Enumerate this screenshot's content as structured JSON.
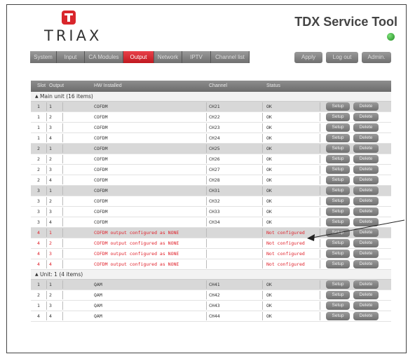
{
  "brand": {
    "logo_text": "TRIAX",
    "tool_title": "TDX Service Tool",
    "status_color": "#2a9d2a"
  },
  "nav": {
    "tabs": [
      {
        "label": "System",
        "active": false
      },
      {
        "label": "Input",
        "active": false
      },
      {
        "label": "CA Modules",
        "active": false
      },
      {
        "label": "Output",
        "active": true
      },
      {
        "label": "Network",
        "active": false
      },
      {
        "label": "IPTV",
        "active": false
      },
      {
        "label": "Channel list",
        "active": false
      }
    ],
    "apply_label": "Apply",
    "logout_label": "Log out",
    "admin_label": "Admin."
  },
  "table": {
    "headers": {
      "slot": "Slot",
      "output": "Output",
      "hw": "HW Installed",
      "channel": "Channel",
      "status": "Status"
    },
    "setup_label": "Setup",
    "delete_label": "Delete",
    "groups": [
      {
        "label": "Main unit (16 items)",
        "rows": [
          {
            "slot": "1",
            "output": "1",
            "hw": "COFDM",
            "channel": "CH21",
            "status": "OK",
            "shade": true,
            "error": false
          },
          {
            "slot": "1",
            "output": "2",
            "hw": "COFDM",
            "channel": "CH22",
            "status": "OK",
            "shade": false,
            "error": false
          },
          {
            "slot": "1",
            "output": "3",
            "hw": "COFDM",
            "channel": "CH23",
            "status": "OK",
            "shade": false,
            "error": false
          },
          {
            "slot": "1",
            "output": "4",
            "hw": "COFDM",
            "channel": "CH24",
            "status": "OK",
            "shade": false,
            "error": false
          },
          {
            "slot": "2",
            "output": "1",
            "hw": "COFDM",
            "channel": "CH25",
            "status": "OK",
            "shade": true,
            "error": false
          },
          {
            "slot": "2",
            "output": "2",
            "hw": "COFDM",
            "channel": "CH26",
            "status": "OK",
            "shade": false,
            "error": false
          },
          {
            "slot": "2",
            "output": "3",
            "hw": "COFDM",
            "channel": "CH27",
            "status": "OK",
            "shade": false,
            "error": false
          },
          {
            "slot": "2",
            "output": "4",
            "hw": "COFDM",
            "channel": "CH28",
            "status": "OK",
            "shade": false,
            "error": false
          },
          {
            "slot": "3",
            "output": "1",
            "hw": "COFDM",
            "channel": "CH31",
            "status": "OK",
            "shade": true,
            "error": false
          },
          {
            "slot": "3",
            "output": "2",
            "hw": "COFDM",
            "channel": "CH32",
            "status": "OK",
            "shade": false,
            "error": false
          },
          {
            "slot": "3",
            "output": "3",
            "hw": "COFDM",
            "channel": "CH33",
            "status": "OK",
            "shade": false,
            "error": false
          },
          {
            "slot": "3",
            "output": "4",
            "hw": "COFDM",
            "channel": "CH34",
            "status": "OK",
            "shade": false,
            "error": false
          },
          {
            "slot": "4",
            "output": "1",
            "hw": "COFDM output configured as NONE",
            "channel": "",
            "status": "Not configured",
            "shade": true,
            "error": true
          },
          {
            "slot": "4",
            "output": "2",
            "hw": "COFDM output configured as NONE",
            "channel": "",
            "status": "Not configured",
            "shade": false,
            "error": true
          },
          {
            "slot": "4",
            "output": "3",
            "hw": "COFDM output configured as NONE",
            "channel": "",
            "status": "Not configured",
            "shade": false,
            "error": true
          },
          {
            "slot": "4",
            "output": "4",
            "hw": "COFDM output configured as NONE",
            "channel": "",
            "status": "Not configured",
            "shade": false,
            "error": true
          }
        ]
      },
      {
        "label": "Unit: 1 (4 items)",
        "rows": [
          {
            "slot": "1",
            "output": "1",
            "hw": "QAM",
            "channel": "CH41",
            "status": "OK",
            "shade": true,
            "error": false
          },
          {
            "slot": "2",
            "output": "2",
            "hw": "QAM",
            "channel": "CH42",
            "status": "OK",
            "shade": false,
            "error": false
          },
          {
            "slot": "1",
            "output": "3",
            "hw": "QAM",
            "channel": "CH43",
            "status": "OK",
            "shade": false,
            "error": false
          },
          {
            "slot": "4",
            "output": "4",
            "hw": "QAM",
            "channel": "CH44",
            "status": "OK",
            "shade": false,
            "error": false
          }
        ]
      }
    ]
  }
}
